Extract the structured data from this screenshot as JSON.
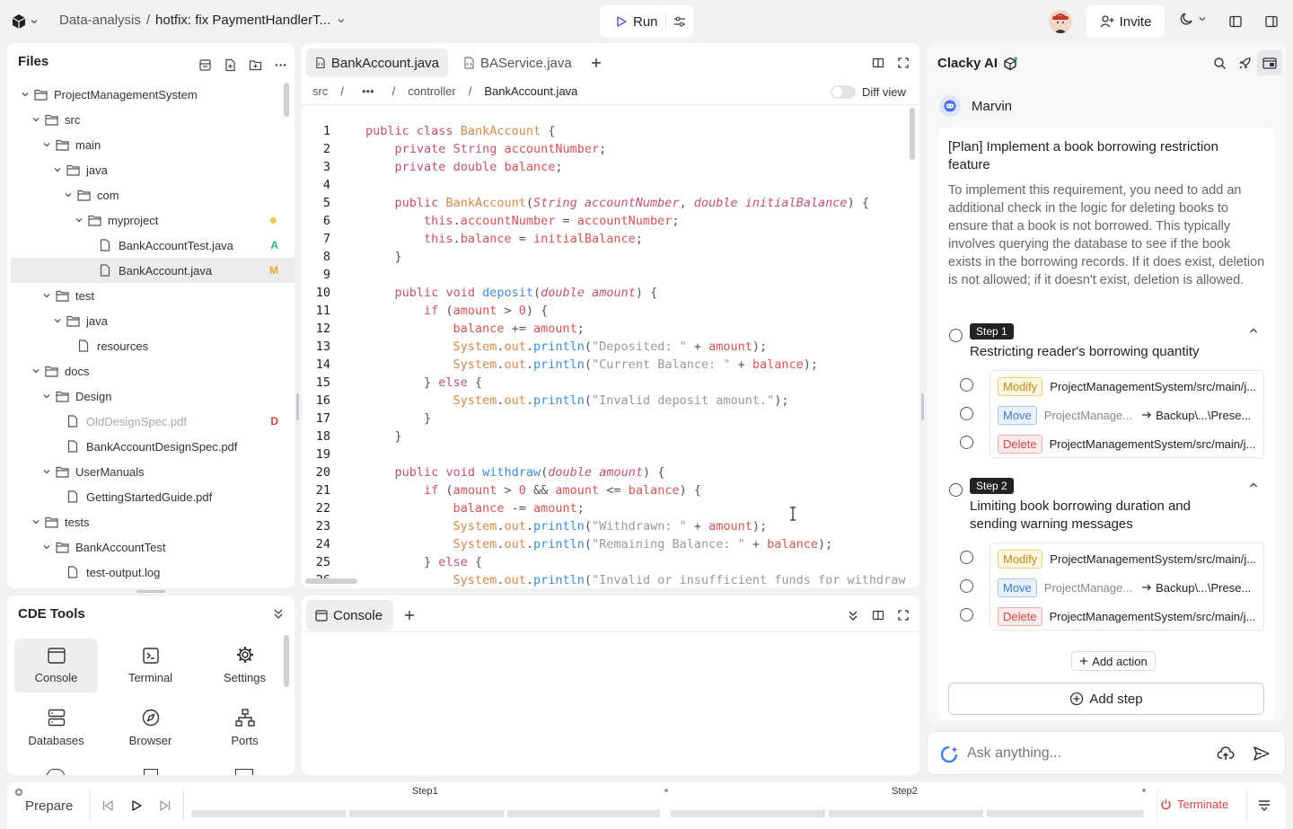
{
  "topbar": {
    "breadcrumb_project": "Data-analysis",
    "breadcrumb_sep": "/",
    "branch": "hotfix: fix PaymentHandlerT...",
    "run_label": "Run",
    "invite_label": "Invite"
  },
  "files": {
    "title": "Files",
    "tree": [
      {
        "label": "ProjectManagementSystem",
        "type": "folder",
        "depth": 0
      },
      {
        "label": "src",
        "type": "folder",
        "depth": 1
      },
      {
        "label": "main",
        "type": "folder",
        "depth": 2
      },
      {
        "label": "java",
        "type": "folder",
        "depth": 3
      },
      {
        "label": "com",
        "type": "folder",
        "depth": 4
      },
      {
        "label": "myproject",
        "type": "folder",
        "depth": 5,
        "dot": true
      },
      {
        "label": "BankAccountTest.java",
        "type": "file",
        "depth": 6,
        "badge": "A"
      },
      {
        "label": "BankAccount.java",
        "type": "file",
        "depth": 6,
        "badge": "M",
        "selected": true
      },
      {
        "label": "test",
        "type": "folder",
        "depth": 2
      },
      {
        "label": "java",
        "type": "folder",
        "depth": 3
      },
      {
        "label": "resources",
        "type": "file",
        "depth": 4
      },
      {
        "label": "docs",
        "type": "folder",
        "depth": 1
      },
      {
        "label": "Design",
        "type": "folder",
        "depth": 2
      },
      {
        "label": "OldDesignSpec.pdf",
        "type": "file",
        "depth": 3,
        "badge": "D",
        "deleted": true
      },
      {
        "label": "BankAccountDesignSpec.pdf",
        "type": "file",
        "depth": 3
      },
      {
        "label": "UserManuals",
        "type": "folder",
        "depth": 2
      },
      {
        "label": "GettingStartedGuide.pdf",
        "type": "file",
        "depth": 3
      },
      {
        "label": "tests",
        "type": "folder",
        "depth": 1
      },
      {
        "label": "BankAccountTest",
        "type": "folder",
        "depth": 2
      },
      {
        "label": "test-output.log",
        "type": "file",
        "depth": 3
      }
    ]
  },
  "cde": {
    "title": "CDE Tools",
    "tools": [
      "Console",
      "Terminal",
      "Settings",
      "Databases",
      "Browser",
      "Ports"
    ]
  },
  "editor": {
    "tabs": [
      "BankAccount.java",
      "BAService.java"
    ],
    "breadcrumb": [
      "src",
      "/",
      "•••",
      "/",
      "controller",
      "/",
      "BankAccount.java"
    ],
    "diff_label": "Diff view",
    "lines": [
      "public class BankAccount {",
      "    private String accountNumber;",
      "    private double balance;",
      "",
      "    public BankAccount(String accountNumber, double initialBalance) {",
      "        this.accountNumber = accountNumber;",
      "        this.balance = initialBalance;",
      "    }",
      "",
      "    public void deposit(double amount) {",
      "        if (amount > 0) {",
      "            balance += amount;",
      "            System.out.println(\"Deposited: \" + amount);",
      "            System.out.println(\"Current Balance: \" + balance);",
      "        } else {",
      "            System.out.println(\"Invalid deposit amount.\");",
      "        }",
      "    }",
      "",
      "    public void withdraw(double amount) {",
      "        if (amount > 0 && amount <= balance) {",
      "            balance -= amount;",
      "            System.out.println(\"Withdrawn: \" + amount);",
      "            System.out.println(\"Remaining Balance: \" + balance);",
      "        } else {",
      "            System.out.println(\"Invalid or insufficient funds for withdraw"
    ]
  },
  "console": {
    "tab_label": "Console"
  },
  "ai": {
    "title": "Clacky AI",
    "user": "Marvin",
    "plan_title": "[Plan] Implement a book borrowing restriction feature",
    "plan_desc": "To implement this requirement, you need to add an additional check in the logic for deleting books to ensure that a book is not borrowed. This typically involves querying the database to see if the book exists in the borrowing records. If it does exist, deletion is not allowed; if it doesn't exist, deletion is allowed.",
    "steps": [
      {
        "tag": "Step 1",
        "title": "Restricting reader's borrowing quantity",
        "actions": [
          {
            "kind": "Modify",
            "path": "ProjectManagementSystem/src/main/j..."
          },
          {
            "kind": "Move",
            "path": "ProjectManage...",
            "dest": "Backup\\...\\Prese..."
          },
          {
            "kind": "Delete",
            "path": "ProjectManagementSystem/src/main/j..."
          }
        ]
      },
      {
        "tag": "Step 2",
        "title": "Limiting book borrowing duration and sending warning messages",
        "actions": [
          {
            "kind": "Modify",
            "path": "ProjectManagementSystem/src/main/j..."
          },
          {
            "kind": "Move",
            "path": "ProjectManage...",
            "dest": "Backup\\...\\Prese..."
          },
          {
            "kind": "Delete",
            "path": "ProjectManagementSystem/src/main/j..."
          }
        ]
      }
    ],
    "add_action": "Add action",
    "add_step": "Add step",
    "ask_placeholder": "Ask anything..."
  },
  "bottom": {
    "prepare": "Prepare",
    "step1": "Step1",
    "step2": "Step2",
    "terminate": "Terminate"
  }
}
